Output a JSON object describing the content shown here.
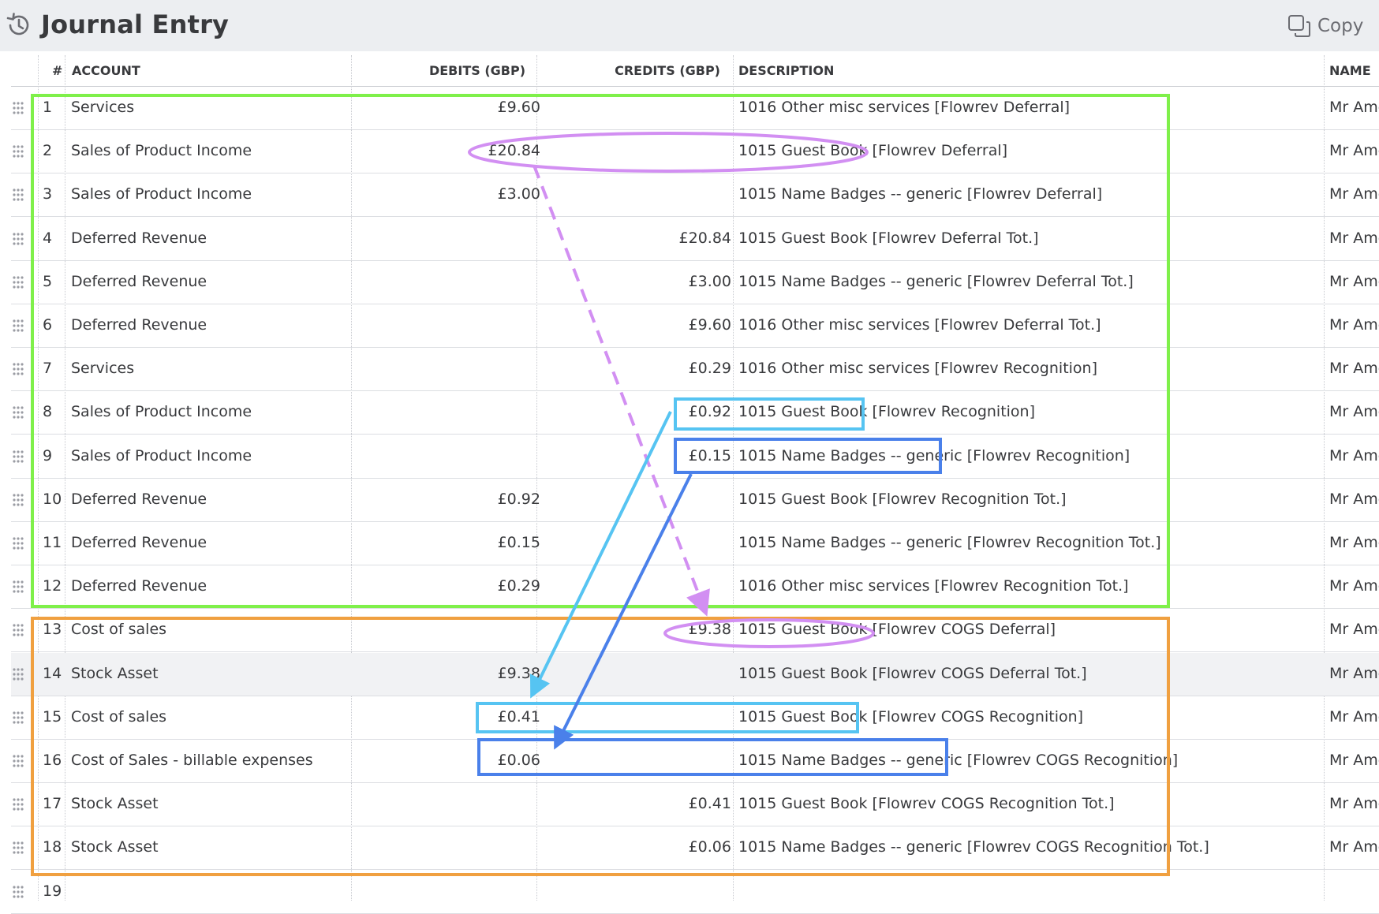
{
  "header": {
    "title": "Journal Entry",
    "copy_label": "Copy",
    "history_icon": "history-icon",
    "copy_icon": "copy-icon"
  },
  "columns": {
    "num": "#",
    "account": "ACCOUNT",
    "debits": "DEBITS (GBP)",
    "credits": "CREDITS (GBP)",
    "description": "DESCRIPTION",
    "name": "NAME"
  },
  "rows": [
    {
      "num": "1",
      "account": "Services",
      "debit": "£9.60",
      "credit": "",
      "description": "1016 Other misc services [Flowrev Deferral]",
      "name": "Mr Ame"
    },
    {
      "num": "2",
      "account": "Sales of Product Income",
      "debit": "£20.84",
      "credit": "",
      "description": "1015 Guest Book [Flowrev Deferral]",
      "name": "Mr Ame"
    },
    {
      "num": "3",
      "account": "Sales of Product Income",
      "debit": "£3.00",
      "credit": "",
      "description": "1015 Name Badges -- generic [Flowrev Deferral]",
      "name": "Mr Ame"
    },
    {
      "num": "4",
      "account": "Deferred Revenue",
      "debit": "",
      "credit": "£20.84",
      "description": "1015 Guest Book [Flowrev Deferral Tot.]",
      "name": "Mr Ame"
    },
    {
      "num": "5",
      "account": "Deferred Revenue",
      "debit": "",
      "credit": "£3.00",
      "description": "1015 Name Badges -- generic [Flowrev Deferral Tot.]",
      "name": "Mr Ame"
    },
    {
      "num": "6",
      "account": "Deferred Revenue",
      "debit": "",
      "credit": "£9.60",
      "description": "1016 Other misc services [Flowrev Deferral Tot.]",
      "name": "Mr Ame"
    },
    {
      "num": "7",
      "account": "Services",
      "debit": "",
      "credit": "£0.29",
      "description": "1016 Other misc services [Flowrev Recognition]",
      "name": "Mr Ame"
    },
    {
      "num": "8",
      "account": "Sales of Product Income",
      "debit": "",
      "credit": "£0.92",
      "description": "1015 Guest Book [Flowrev Recognition]",
      "name": "Mr Ame"
    },
    {
      "num": "9",
      "account": "Sales of Product Income",
      "debit": "",
      "credit": "£0.15",
      "description": "1015 Name Badges -- generic [Flowrev Recognition]",
      "name": "Mr Ame"
    },
    {
      "num": "10",
      "account": "Deferred Revenue",
      "debit": "£0.92",
      "credit": "",
      "description": "1015 Guest Book [Flowrev Recognition Tot.]",
      "name": "Mr Ame"
    },
    {
      "num": "11",
      "account": "Deferred Revenue",
      "debit": "£0.15",
      "credit": "",
      "description": "1015 Name Badges -- generic [Flowrev Recognition Tot.]",
      "name": "Mr Ame"
    },
    {
      "num": "12",
      "account": "Deferred Revenue",
      "debit": "£0.29",
      "credit": "",
      "description": "1016 Other misc services [Flowrev Recognition Tot.]",
      "name": "Mr Ame"
    },
    {
      "num": "13",
      "account": "Cost of sales",
      "debit": "",
      "credit": "£9.38",
      "description": "1015 Guest Book [Flowrev COGS Deferral]",
      "name": "Mr Ame"
    },
    {
      "num": "14",
      "account": "Stock Asset",
      "debit": "£9.38",
      "credit": "",
      "description": "1015 Guest Book [Flowrev COGS Deferral Tot.]",
      "name": "Mr Ame"
    },
    {
      "num": "15",
      "account": "Cost of sales",
      "debit": "£0.41",
      "credit": "",
      "description": "1015 Guest Book [Flowrev COGS Recognition]",
      "name": "Mr Ame"
    },
    {
      "num": "16",
      "account": "Cost of Sales - billable expenses",
      "debit": "£0.06",
      "credit": "",
      "description": "1015 Name Badges -- generic [Flowrev COGS Recognition]",
      "name": "Mr Ame"
    },
    {
      "num": "17",
      "account": "Stock Asset",
      "debit": "",
      "credit": "£0.41",
      "description": "1015 Guest Book [Flowrev COGS Recognition Tot.]",
      "name": "Mr Ame"
    },
    {
      "num": "18",
      "account": "Stock Asset",
      "debit": "",
      "credit": "£0.06",
      "description": "1015 Name Badges -- generic [Flowrev COGS Recognition Tot.]",
      "name": "Mr Ame"
    },
    {
      "num": "19",
      "account": "",
      "debit": "",
      "credit": "",
      "description": "",
      "name": ""
    }
  ],
  "annotation_colors": {
    "green_box": "#7ff04a",
    "orange_box": "#f0a040",
    "purple_ellipse": "#d28ff2",
    "light_blue": "#56c4f2",
    "dark_blue": "#4a80ea"
  }
}
